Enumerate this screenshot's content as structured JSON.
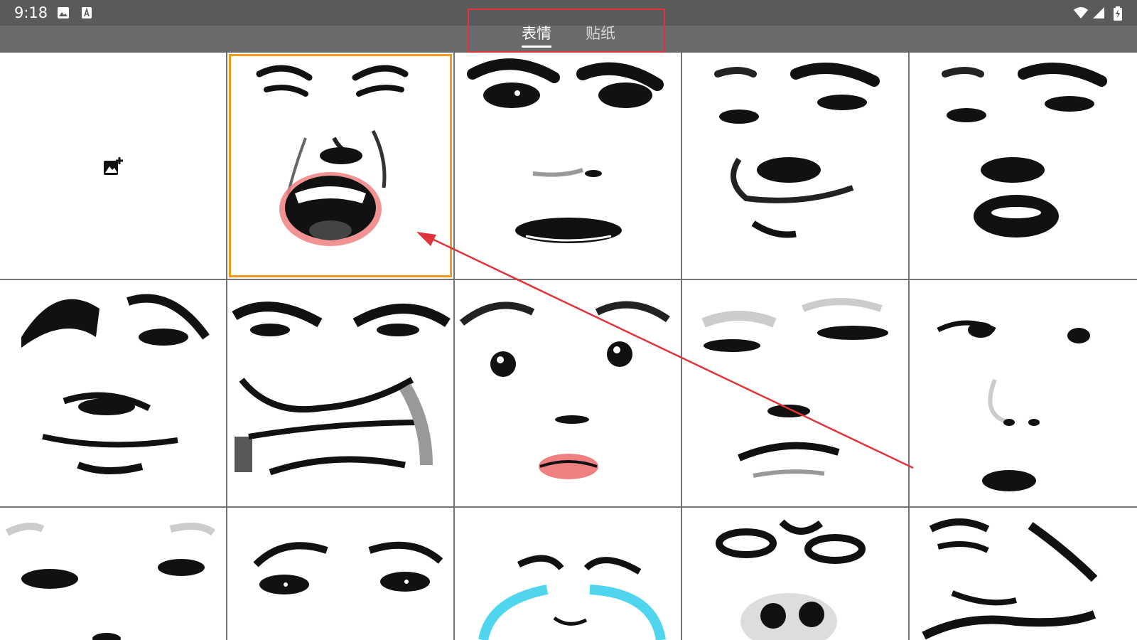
{
  "status_bar": {
    "time": "9:18",
    "left_icons": [
      "image-icon",
      "keyboard-a-icon"
    ],
    "right_icons": [
      "wifi-icon",
      "signal-icon",
      "battery-charging-icon"
    ]
  },
  "tabs": [
    {
      "label": "表情",
      "active": true
    },
    {
      "label": "贴纸",
      "active": false
    }
  ],
  "grid": {
    "columns": 5,
    "visible_rows": 3,
    "first_cell": "add-image-icon",
    "selected_cell": 1,
    "selection_color": "#f39a1f"
  },
  "colors": {
    "status_bar": "#5a5a5a",
    "tab_bar": "#6b6b6b",
    "annotation_red": "#e1333b",
    "blush_pink": "#f08080",
    "tear_cyan": "#4fd6ee"
  }
}
